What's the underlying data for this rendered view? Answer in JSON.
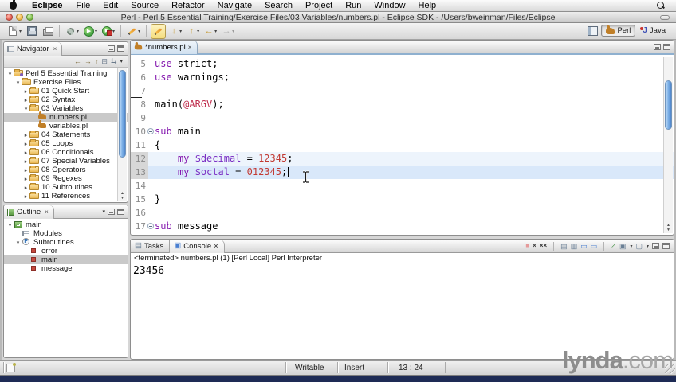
{
  "menubar": {
    "items": [
      "Eclipse",
      "File",
      "Edit",
      "Source",
      "Refactor",
      "Navigate",
      "Search",
      "Project",
      "Run",
      "Window",
      "Help"
    ]
  },
  "titlebar": {
    "title": "Perl - Perl 5 Essential Training/Exercise Files/03 Variables/numbers.pl - Eclipse SDK - /Users/bweinman/Files/Eclipse"
  },
  "perspectives": {
    "perl": "Perl",
    "java": "Java"
  },
  "navigator": {
    "title": "Navigator",
    "tree": [
      {
        "label": "Perl 5 Essential Training",
        "level": 0,
        "arrow": "open",
        "icon": "project"
      },
      {
        "label": "Exercise Files",
        "level": 1,
        "arrow": "open",
        "icon": "folder"
      },
      {
        "label": "01 Quick Start",
        "level": 2,
        "arrow": "closed",
        "icon": "folder"
      },
      {
        "label": "02 Syntax",
        "level": 2,
        "arrow": "closed",
        "icon": "folder"
      },
      {
        "label": "03 Variables",
        "level": 2,
        "arrow": "open",
        "icon": "folder"
      },
      {
        "label": "numbers.pl",
        "level": 3,
        "arrow": "none",
        "icon": "perl",
        "selected": true
      },
      {
        "label": "variables.pl",
        "level": 3,
        "arrow": "none",
        "icon": "perl"
      },
      {
        "label": "04 Statements",
        "level": 2,
        "arrow": "closed",
        "icon": "folder"
      },
      {
        "label": "05 Loops",
        "level": 2,
        "arrow": "closed",
        "icon": "folder"
      },
      {
        "label": "06 Conditionals",
        "level": 2,
        "arrow": "closed",
        "icon": "folder"
      },
      {
        "label": "07 Special Variables",
        "level": 2,
        "arrow": "closed",
        "icon": "folder"
      },
      {
        "label": "08 Operators",
        "level": 2,
        "arrow": "closed",
        "icon": "folder"
      },
      {
        "label": "09 Regexes",
        "level": 2,
        "arrow": "closed",
        "icon": "folder"
      },
      {
        "label": "10 Subroutines",
        "level": 2,
        "arrow": "closed",
        "icon": "folder"
      },
      {
        "label": "11 References",
        "level": 2,
        "arrow": "closed",
        "icon": "folder"
      }
    ]
  },
  "outline": {
    "title": "Outline",
    "tree": [
      {
        "label": "main",
        "level": 0,
        "arrow": "open",
        "icon": "module"
      },
      {
        "label": "Modules",
        "level": 1,
        "arrow": "none",
        "icon": "modules"
      },
      {
        "label": "Subroutines",
        "level": 1,
        "arrow": "open",
        "icon": "subs"
      },
      {
        "label": "error",
        "level": 2,
        "arrow": "none",
        "icon": "sub"
      },
      {
        "label": "main",
        "level": 2,
        "arrow": "none",
        "icon": "sub",
        "selected": true
      },
      {
        "label": "message",
        "level": 2,
        "arrow": "none",
        "icon": "sub"
      }
    ]
  },
  "editor": {
    "tab": "*numbers.pl",
    "lines": [
      {
        "n": "5",
        "tk": [
          [
            "use",
            "kw"
          ],
          [
            " strict;",
            ""
          ]
        ]
      },
      {
        "n": "6",
        "tk": [
          [
            "use",
            "kw"
          ],
          [
            " warnings;",
            ""
          ]
        ]
      },
      {
        "n": "7",
        "tk": [],
        "foldEnd": true
      },
      {
        "n": "8",
        "tk": [
          [
            "main(",
            ""
          ],
          [
            "@ARGV",
            "arr"
          ],
          [
            ");",
            ""
          ]
        ]
      },
      {
        "n": "9",
        "tk": []
      },
      {
        "n": "10",
        "tk": [
          [
            "sub",
            "kw"
          ],
          [
            " main",
            ""
          ]
        ],
        "fold": true
      },
      {
        "n": "11",
        "tk": [
          [
            "{",
            ""
          ]
        ]
      },
      {
        "n": "12",
        "tk": [
          [
            "    ",
            ""
          ],
          [
            "my",
            "kw"
          ],
          [
            " ",
            ""
          ],
          [
            "$decimal",
            "var"
          ],
          [
            " = ",
            ""
          ],
          [
            "12345",
            "num"
          ],
          [
            ";",
            ""
          ]
        ],
        "changed": true,
        "nearCurrent": true
      },
      {
        "n": "13",
        "tk": [
          [
            "    ",
            ""
          ],
          [
            "my",
            "kw"
          ],
          [
            " ",
            ""
          ],
          [
            "$octal",
            "var"
          ],
          [
            " = ",
            ""
          ],
          [
            "012345",
            "num"
          ],
          [
            ";",
            ""
          ]
        ],
        "changed": true,
        "current": true,
        "caret": true
      },
      {
        "n": "14",
        "tk": []
      },
      {
        "n": "15",
        "tk": [
          [
            "}",
            ""
          ]
        ]
      },
      {
        "n": "16",
        "tk": []
      },
      {
        "n": "17",
        "tk": [
          [
            "sub",
            "kw"
          ],
          [
            " message",
            ""
          ]
        ],
        "fold": true
      }
    ]
  },
  "console": {
    "tasks_tab": "Tasks",
    "console_tab": "Console",
    "header": "<terminated> numbers.pl (1) [Perl Local] Perl Interpreter",
    "output": "23456"
  },
  "statusbar": {
    "writable": "Writable",
    "insert": "Insert",
    "position": "13 : 24"
  },
  "watermark": {
    "bold": "lynda",
    "rest": ".com"
  },
  "icons": {
    "close": "×",
    "twistie_open": "▾",
    "twistie_closed": "▸",
    "back": "←",
    "forward": "→",
    "up": "↑",
    "down": "↓",
    "collapse_all": "⊟",
    "link_editor": "⇆",
    "chevron": "▾",
    "play": "▶",
    "cross": "×",
    "double_cross": "××",
    "clear": "▤",
    "scroll_lock": "▥",
    "wrap": "▭",
    "pin": "↗",
    "display_console": "▣",
    "open_console": "▢",
    "tasks": "▤",
    "console_glyph": "▣",
    "scroll_up": "▲",
    "scroll_down": "▼"
  }
}
